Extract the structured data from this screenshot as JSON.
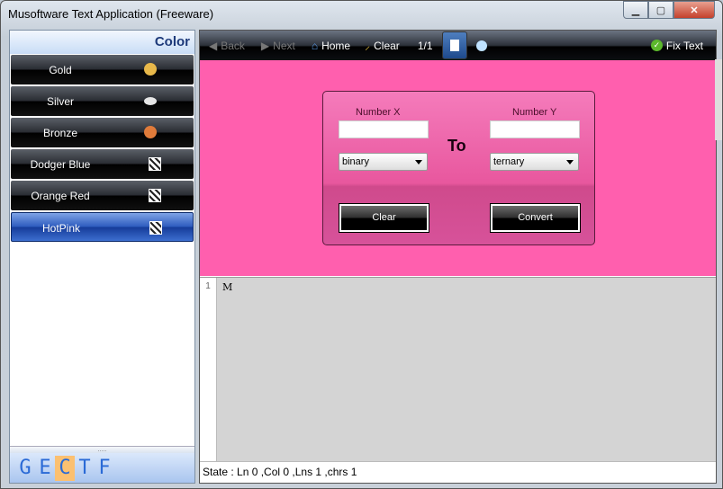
{
  "window": {
    "title": "Musoftware Text Application (Freeware)",
    "controls": [
      "minimize",
      "maximize",
      "close"
    ]
  },
  "sidebar": {
    "header": "Color",
    "items": [
      {
        "label": "Gold",
        "icon": "gold-coins-icon",
        "color": "#e8b84a"
      },
      {
        "label": "Silver",
        "icon": "silver-coin-icon",
        "color": "#e6e6e6"
      },
      {
        "label": "Bronze",
        "icon": "bronze-coin-icon",
        "color": "#e07b3a"
      },
      {
        "label": "Dodger Blue",
        "icon": "flag-icon"
      },
      {
        "label": "Orange Red",
        "icon": "flag-icon"
      },
      {
        "label": "HotPink",
        "icon": "flag-icon",
        "selected": true
      }
    ],
    "splitter": ".....",
    "bottom_letters": [
      "G",
      "E",
      "C",
      "T",
      "F"
    ],
    "active_letter": "C"
  },
  "toolbar": {
    "back": "Back",
    "next": "Next",
    "home": "Home",
    "clear": "Clear",
    "page": "1/1",
    "fix_text": "Fix Text"
  },
  "converter": {
    "label_x": "Number X",
    "label_y": "Number Y",
    "value_x": "",
    "value_y": "",
    "to": "To",
    "base_x": "binary",
    "base_y": "ternary",
    "clear": "Clear",
    "convert": "Convert",
    "background": "#ff5fae"
  },
  "editor": {
    "line_number": "1",
    "text": "M"
  },
  "status": "State :  Ln 0 ,Col 0 ,Lns 1 ,chrs 1"
}
